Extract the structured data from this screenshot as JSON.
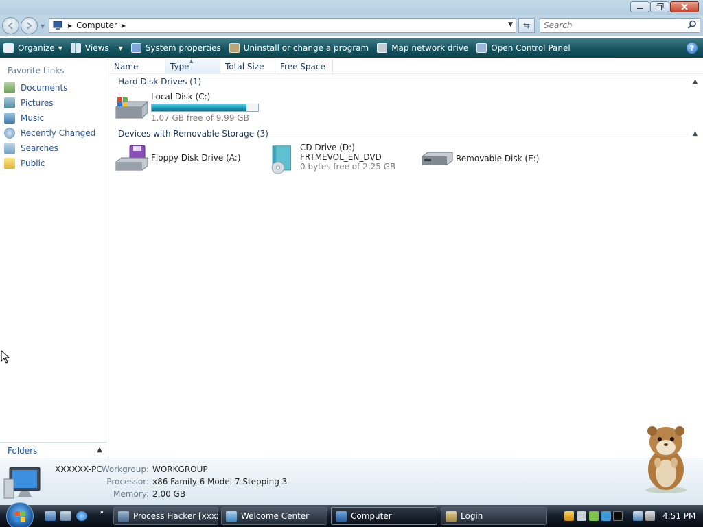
{
  "window": {
    "address_crumb": "Computer",
    "search_placeholder": "Search"
  },
  "toolbar": {
    "organize": "Organize",
    "views": "Views",
    "system_properties": "System properties",
    "uninstall": "Uninstall or change a program",
    "map_network_drive": "Map network drive",
    "open_control_panel": "Open Control Panel"
  },
  "sidebar": {
    "heading": "Favorite Links",
    "items": [
      {
        "label": "Documents",
        "icon": "documents-icon"
      },
      {
        "label": "Pictures",
        "icon": "pictures-icon"
      },
      {
        "label": "Music",
        "icon": "music-icon"
      },
      {
        "label": "Recently Changed",
        "icon": "recently-changed-icon"
      },
      {
        "label": "Searches",
        "icon": "searches-icon"
      },
      {
        "label": "Public",
        "icon": "public-folder-icon"
      }
    ],
    "folders_label": "Folders"
  },
  "columns": [
    "Name",
    "Type",
    "Total Size",
    "Free Space"
  ],
  "groups": {
    "hard_disk": {
      "title": "Hard Disk Drives (1)",
      "drives": [
        {
          "name": "Local Disk (C:)",
          "free_text": "1.07 GB free of 9.99 GB",
          "used_fraction": 0.89
        }
      ]
    },
    "removable": {
      "title": "Devices with Removable Storage (3)",
      "drives": [
        {
          "name": "Floppy Disk Drive (A:)"
        },
        {
          "name": "CD Drive (D:)",
          "label": "FRTMEVOL_EN_DVD",
          "free_text": "0 bytes free of 2.25 GB"
        },
        {
          "name": "Removable Disk (E:)"
        }
      ]
    }
  },
  "details": {
    "pc_name": "XXXXXX-PC",
    "workgroup_label": "Workgroup:",
    "workgroup": "WORKGROUP",
    "processor_label": "Processor:",
    "processor": "x86 Family 6 Model 7 Stepping 3",
    "memory_label": "Memory:",
    "memory": "2.00 GB"
  },
  "taskbar": {
    "tasks": [
      {
        "label": "Process Hacker [xxxx...",
        "active": false
      },
      {
        "label": "Welcome Center",
        "active": false
      },
      {
        "label": "Computer",
        "active": true
      },
      {
        "label": "Login",
        "active": false
      }
    ],
    "quicklaunch_more": "»",
    "clock": "4:51 PM"
  },
  "colors": {
    "link_blue": "#1f56a6",
    "command_bar": "#16545f",
    "capacity_bar": "#1a95b3"
  }
}
